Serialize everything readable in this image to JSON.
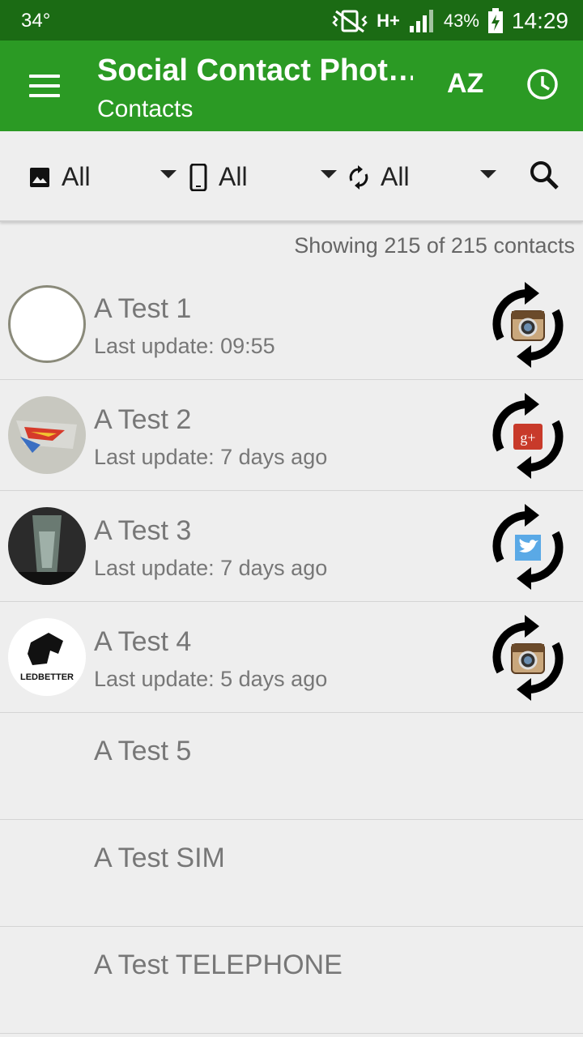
{
  "status_bar": {
    "temperature": "34°",
    "network": "H+",
    "battery": "43%",
    "time": "14:29"
  },
  "app_bar": {
    "title": "Social Contact Phot…",
    "subtitle": "Contacts",
    "sort_label": "AZ"
  },
  "filters": [
    {
      "icon": "image-icon",
      "value": "All"
    },
    {
      "icon": "phone-icon",
      "value": "All"
    },
    {
      "icon": "sync-icon",
      "value": "All"
    }
  ],
  "summary": "Showing 215 of 215 contacts",
  "contacts": [
    {
      "name": "A Test 1",
      "update": "Last update: 09:55",
      "source": "instagram"
    },
    {
      "name": "A Test 2",
      "update": "Last update: 7 days ago",
      "source": "google-plus"
    },
    {
      "name": "A Test 3",
      "update": "Last update: 7 days ago",
      "source": "twitter"
    },
    {
      "name": "A Test 4",
      "update": "Last update: 5 days ago",
      "source": "instagram",
      "avatar_text": "LEDBETTER"
    },
    {
      "name": "A Test 5",
      "update": "",
      "source": ""
    },
    {
      "name": "A Test SIM",
      "update": "",
      "source": ""
    },
    {
      "name": "A Test TELEPHONE",
      "update": "",
      "source": ""
    }
  ],
  "colors": {
    "status_bar": "#1b6b14",
    "app_bar": "#2b9a24",
    "background": "#eeeeee",
    "text_muted": "#777777"
  }
}
